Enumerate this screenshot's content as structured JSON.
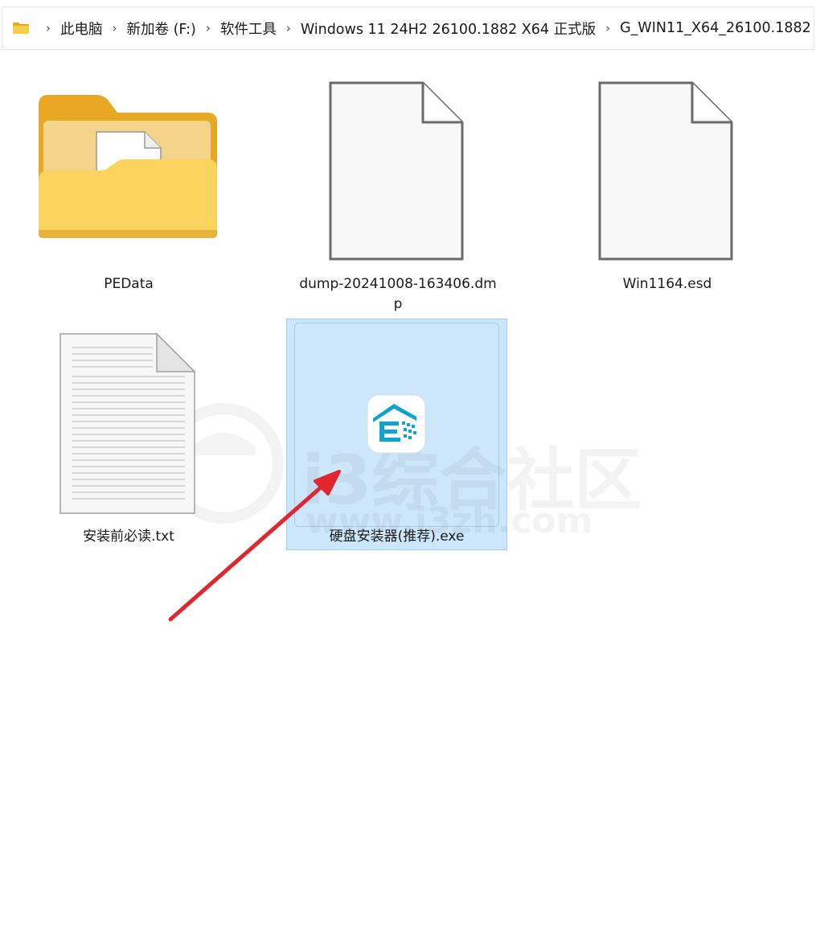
{
  "breadcrumb": {
    "icon": "folder-icon",
    "items": [
      "此电脑",
      "新加卷 (F:)",
      "软件工具",
      "Windows 11 24H2 26100.1882 X64 正式版",
      "G_WIN11_X64_26100.1882"
    ],
    "separator": "›"
  },
  "files": [
    {
      "name": "PEData",
      "icon": "folder-icon"
    },
    {
      "name": "dump-20241008-163406.dmp",
      "name_line1": "dump-20241008-163406.dm",
      "name_line2": "p",
      "icon": "blank-file-icon"
    },
    {
      "name": "Win1164.esd",
      "icon": "blank-file-icon"
    },
    {
      "name": "安装前必读.txt",
      "icon": "text-file-icon"
    },
    {
      "name": "硬盘安装器(推荐).exe",
      "icon": "installer-app-icon",
      "selected": true
    }
  ],
  "watermark": {
    "title": "i3综合社区",
    "url": "www.i3zh.com"
  },
  "colors": {
    "selection_bg": "#cce6fb",
    "selection_border": "#99d1f9",
    "arrow": "#e0262f",
    "folder": "#f7c948"
  }
}
